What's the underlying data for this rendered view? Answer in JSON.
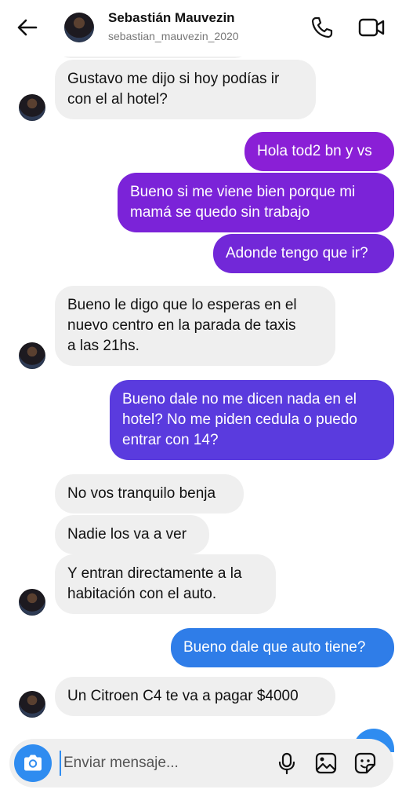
{
  "header": {
    "name": "Sebastián Mauvezin",
    "username": "sebastian_mauvezin_2020"
  },
  "messages": [
    {
      "side": "in",
      "text": "Gustavo me dijo si hoy podías ir\ncon el al hotel?"
    },
    {
      "side": "out",
      "text": "Hola tod2 bn y vs",
      "color": "#8a1fd6"
    },
    {
      "side": "out",
      "text": "Bueno si me viene bien porque mi\nmamá se quedo sin trabajo",
      "color": "#7b23d8"
    },
    {
      "side": "out",
      "text": "Adonde tengo que ir?",
      "color": "#7228d8"
    },
    {
      "side": "in",
      "text": "Bueno le digo que lo esperas en el\nnuevo centro en la parada de taxis\na las 21hs."
    },
    {
      "side": "out",
      "text": "Bueno dale no me dicen nada en el\nhotel? No me piden cedula o puedo\nentrar con 14?",
      "color": "#5a3bde"
    },
    {
      "side": "in",
      "text": "No vos tranquilo benja"
    },
    {
      "side": "in",
      "text": "Nadie los va a ver"
    },
    {
      "side": "in",
      "text": "Y entran directamente a la\nhabitación con el auto."
    },
    {
      "side": "out",
      "text": "Bueno dale que auto tiene?",
      "color": "#2f7de8"
    },
    {
      "side": "in",
      "text": "Un Citroen C4  te va a pagar $4000"
    }
  ],
  "composer": {
    "placeholder": "Enviar mensaje..."
  },
  "icons": {
    "back": "arrow-left-icon",
    "call": "phone-icon",
    "video": "video-camera-icon",
    "camera": "camera-icon",
    "mic": "microphone-icon",
    "gallery": "image-icon",
    "sticker": "sticker-icon"
  }
}
